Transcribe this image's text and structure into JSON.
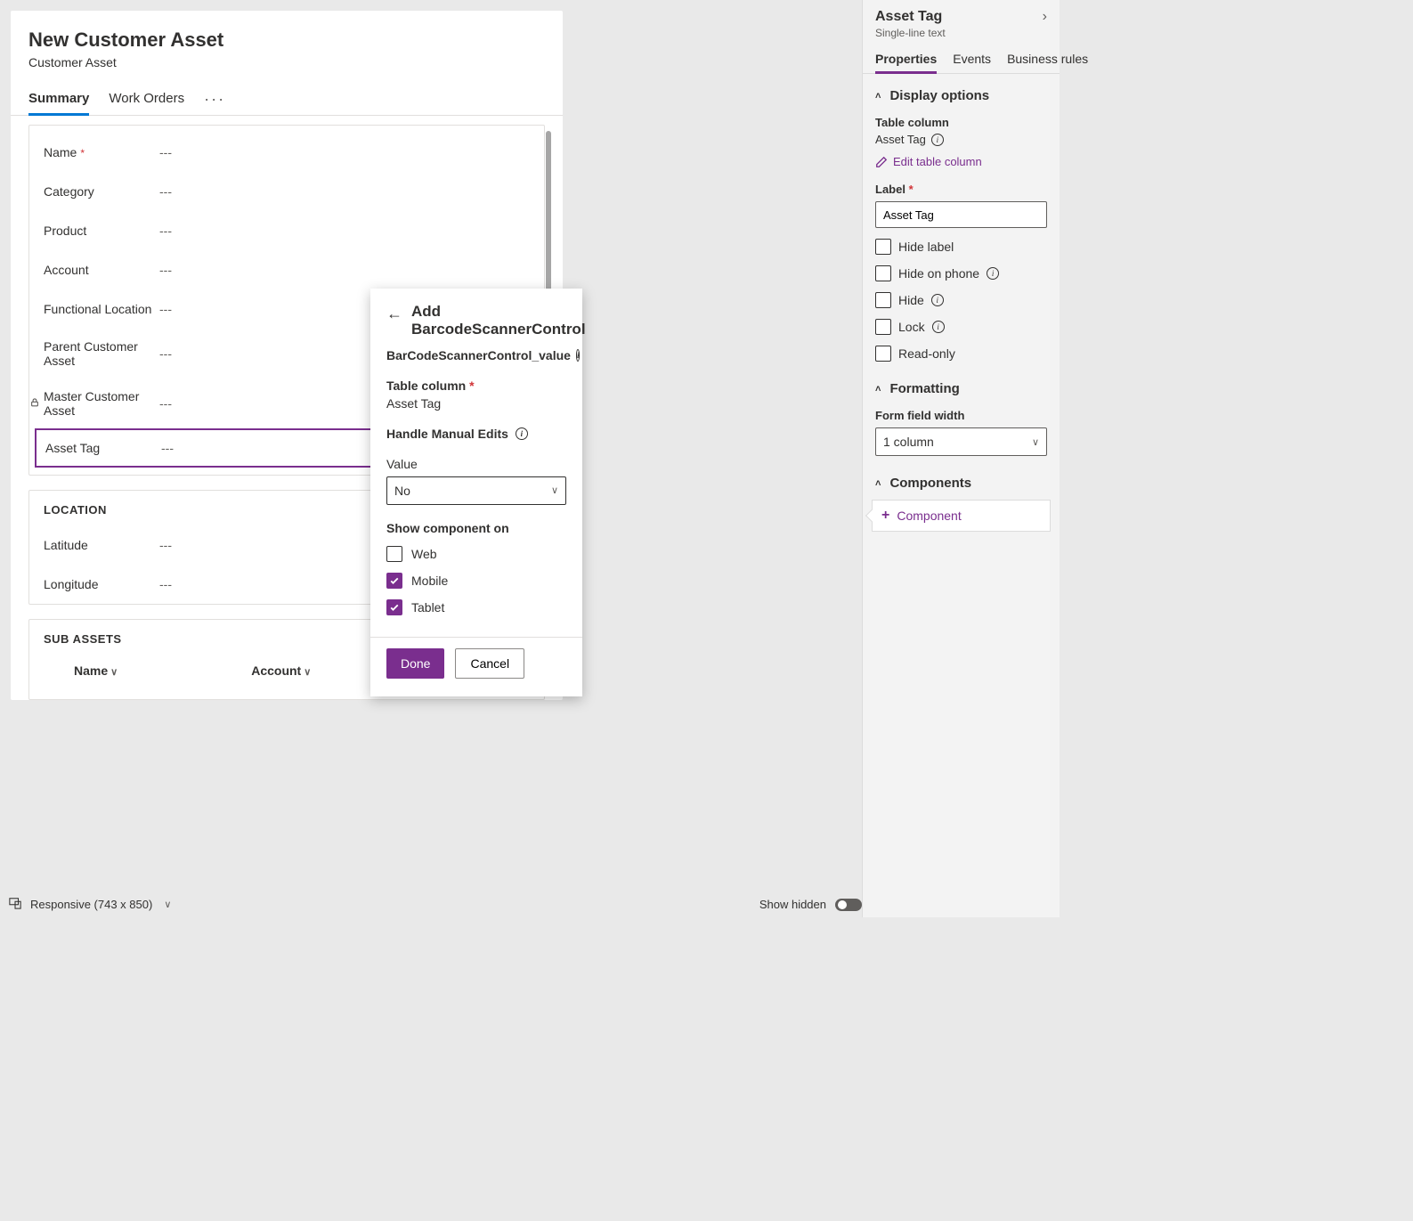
{
  "form": {
    "title": "New Customer Asset",
    "subtitle": "Customer Asset",
    "tabs": [
      "Summary",
      "Work Orders"
    ],
    "active_tab": 0,
    "fields": [
      {
        "label": "Name",
        "value": "---",
        "required": true
      },
      {
        "label": "Category",
        "value": "---"
      },
      {
        "label": "Product",
        "value": "---"
      },
      {
        "label": "Account",
        "value": "---"
      },
      {
        "label": "Functional Location",
        "value": "---"
      },
      {
        "label": "Parent Customer Asset",
        "value": "---"
      },
      {
        "label": "Master Customer Asset",
        "value": "---",
        "locked": true
      },
      {
        "label": "Asset Tag",
        "value": "---",
        "selected": true
      }
    ],
    "location_section": {
      "title": "LOCATION",
      "fields": [
        {
          "label": "Latitude",
          "value": "---"
        },
        {
          "label": "Longitude",
          "value": "---"
        }
      ]
    },
    "subassets_section": {
      "title": "SUB ASSETS",
      "columns": [
        "Name",
        "Account"
      ]
    }
  },
  "footer": {
    "responsive_label": "Responsive (743 x 850)",
    "show_hidden_label": "Show hidden"
  },
  "popup": {
    "title_line1": "Add",
    "title_line2": "BarcodeScannerControl",
    "subtitle": "BarCodeScannerControl_value",
    "table_column_label": "Table column",
    "table_column_value": "Asset Tag",
    "handle_label": "Handle Manual Edits",
    "value_label": "Value",
    "value_selected": "No",
    "show_on_label": "Show component on",
    "show_on": [
      {
        "label": "Web",
        "checked": false
      },
      {
        "label": "Mobile",
        "checked": true
      },
      {
        "label": "Tablet",
        "checked": true
      }
    ],
    "done": "Done",
    "cancel": "Cancel"
  },
  "panel": {
    "title": "Asset Tag",
    "subtitle": "Single-line text",
    "tabs": [
      "Properties",
      "Events",
      "Business rules"
    ],
    "active_tab": 0,
    "display": {
      "heading": "Display options",
      "table_col_label": "Table column",
      "table_col_value": "Asset Tag",
      "edit_link": "Edit table column",
      "label_label": "Label",
      "label_value": "Asset Tag",
      "checks": [
        {
          "label": "Hide label",
          "info": false
        },
        {
          "label": "Hide on phone",
          "info": true
        },
        {
          "label": "Hide",
          "info": true
        },
        {
          "label": "Lock",
          "info": true
        },
        {
          "label": "Read-only",
          "info": false
        }
      ]
    },
    "formatting": {
      "heading": "Formatting",
      "width_label": "Form field width",
      "width_value": "1 column"
    },
    "components": {
      "heading": "Components",
      "add_label": "Component"
    }
  }
}
